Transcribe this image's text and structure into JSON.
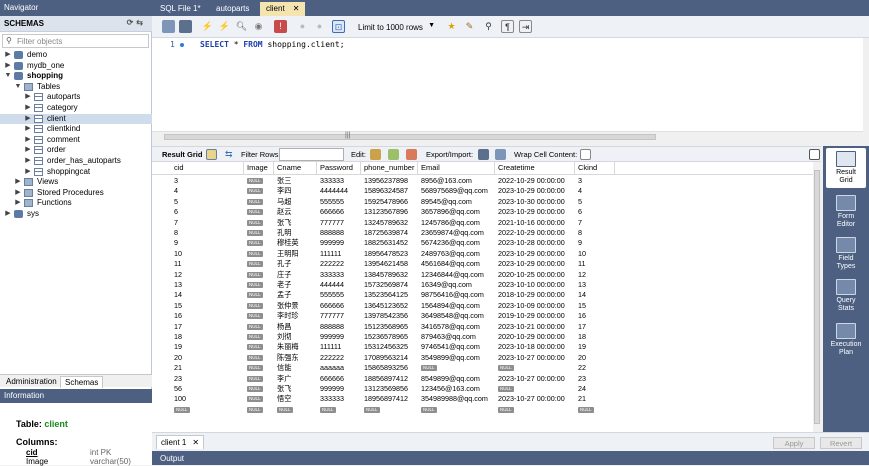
{
  "navigator": {
    "title": "Navigator",
    "schemas_header": "SCHEMAS",
    "filter_placeholder": "Filter objects",
    "tree": [
      {
        "label": "demo",
        "level": 0,
        "type": "db",
        "arrow": "▶",
        "bold": false,
        "selected": false
      },
      {
        "label": "mydb_one",
        "level": 0,
        "type": "db",
        "arrow": "▶",
        "bold": false,
        "selected": false
      },
      {
        "label": "shopping",
        "level": 0,
        "type": "db",
        "arrow": "▼",
        "bold": true,
        "selected": false
      },
      {
        "label": "Tables",
        "level": 1,
        "type": "folder",
        "arrow": "▼",
        "bold": false,
        "selected": false
      },
      {
        "label": "autoparts",
        "level": 2,
        "type": "table",
        "arrow": "▶",
        "bold": false,
        "selected": false
      },
      {
        "label": "category",
        "level": 2,
        "type": "table",
        "arrow": "▶",
        "bold": false,
        "selected": false
      },
      {
        "label": "client",
        "level": 2,
        "type": "table",
        "arrow": "▶",
        "bold": false,
        "selected": true
      },
      {
        "label": "clientkind",
        "level": 2,
        "type": "table",
        "arrow": "▶",
        "bold": false,
        "selected": false
      },
      {
        "label": "comment",
        "level": 2,
        "type": "table",
        "arrow": "▶",
        "bold": false,
        "selected": false
      },
      {
        "label": "order",
        "level": 2,
        "type": "table",
        "arrow": "▶",
        "bold": false,
        "selected": false
      },
      {
        "label": "order_has_autoparts",
        "level": 2,
        "type": "table",
        "arrow": "▶",
        "bold": false,
        "selected": false
      },
      {
        "label": "shoppingcat",
        "level": 2,
        "type": "table",
        "arrow": "▶",
        "bold": false,
        "selected": false
      },
      {
        "label": "Views",
        "level": 1,
        "type": "folder",
        "arrow": "▶",
        "bold": false,
        "selected": false
      },
      {
        "label": "Stored Procedures",
        "level": 1,
        "type": "folder",
        "arrow": "▶",
        "bold": false,
        "selected": false
      },
      {
        "label": "Functions",
        "level": 1,
        "type": "folder",
        "arrow": "▶",
        "bold": false,
        "selected": false
      },
      {
        "label": "sys",
        "level": 0,
        "type": "db",
        "arrow": "▶",
        "bold": false,
        "selected": false
      }
    ],
    "tabs": {
      "administration": "Administration",
      "schemas": "Schemas"
    },
    "info_title": "Information",
    "info": {
      "table_label": "Table:",
      "table_name": "client",
      "columns_label": "Columns:",
      "columns": [
        {
          "name": "cid",
          "type": "int PK"
        },
        {
          "name": "Image",
          "type": "varchar(50)"
        }
      ]
    }
  },
  "doc_tabs": [
    {
      "label": "SQL File 1*",
      "active": false,
      "closable": false
    },
    {
      "label": "autoparts",
      "active": false,
      "closable": false
    },
    {
      "label": "client",
      "active": true,
      "closable": true
    }
  ],
  "toolbar": {
    "limit_label": "Limit to 1000 rows"
  },
  "editor": {
    "line_number": "1",
    "sql": {
      "kw1": "SELECT",
      "star": " * ",
      "kw2": "FROM",
      "rest": " shopping.client;"
    }
  },
  "result_toolbar": {
    "result_grid": "Result Grid",
    "filter_rows": "Filter Rows:",
    "edit": "Edit:",
    "export_import": "Export/Import:",
    "wrap": "Wrap Cell Content:"
  },
  "grid": {
    "columns": [
      "cid",
      "Image",
      "Cname",
      "Password",
      "phone_number",
      "Email",
      "Createtime",
      "Ckind"
    ],
    "null_label": "NULL",
    "rows": [
      [
        "3",
        "NULL",
        "张三",
        "333333",
        "13956237898",
        "8956@163.com",
        "2022-10-29 00:00:00",
        "3"
      ],
      [
        "4",
        "NULL",
        "李四",
        "4444444",
        "15896324587",
        "568975689@qq.com",
        "2023-10-29 00:00:00",
        "4"
      ],
      [
        "5",
        "NULL",
        "马超",
        "555555",
        "15925478966",
        "89545@qq.com",
        "2023-10-30 00:00:00",
        "5"
      ],
      [
        "6",
        "NULL",
        "赵云",
        "666666",
        "13123567896",
        "3657896@qq.com",
        "2023-10-29 00:00:00",
        "6"
      ],
      [
        "7",
        "NULL",
        "张飞",
        "777777",
        "13245789632",
        "1245786@qq.com",
        "2021-10-16 00:00:00",
        "7"
      ],
      [
        "8",
        "NULL",
        "孔明",
        "888888",
        "18725639874",
        "23659874@qq.com",
        "2022-10-29 00:00:00",
        "8"
      ],
      [
        "9",
        "NULL",
        "穆桂英",
        "999999",
        "18825631452",
        "5674236@qq.com",
        "2023-10-28 00:00:00",
        "9"
      ],
      [
        "10",
        "NULL",
        "王明阳",
        "111111",
        "18956478523",
        "2489763@qq.com",
        "2023-10-29 00:00:00",
        "10"
      ],
      [
        "11",
        "NULL",
        "孔子",
        "222222",
        "13954621458",
        "4561684@qq.com",
        "2023-10-29 00:00:00",
        "11"
      ],
      [
        "12",
        "NULL",
        "庄子",
        "333333",
        "13845789632",
        "12346844@qq.com",
        "2020-10-25 00:00:00",
        "12"
      ],
      [
        "13",
        "NULL",
        "老子",
        "444444",
        "15732569874",
        "16349@qq.com",
        "2023-10-10 00:00:00",
        "13"
      ],
      [
        "14",
        "NULL",
        "孟子",
        "555555",
        "13523564125",
        "98756416@qq.com",
        "2018-10-29 00:00:00",
        "14"
      ],
      [
        "15",
        "NULL",
        "张仲景",
        "666666",
        "13645123652",
        "1564894@qq.com",
        "2023-10-09 00:00:00",
        "15"
      ],
      [
        "16",
        "NULL",
        "李时珍",
        "777777",
        "13978542356",
        "36498548@qq.com",
        "2019-10-29 00:00:00",
        "16"
      ],
      [
        "17",
        "NULL",
        "杨昌",
        "888888",
        "15123568965",
        "3416578@qq.com",
        "2023-10-21 00:00:00",
        "17"
      ],
      [
        "18",
        "NULL",
        "刘彻",
        "999999",
        "15236578965",
        "879463@qq.com",
        "2020-10-29 00:00:00",
        "18"
      ],
      [
        "19",
        "NULL",
        "朱丽梅",
        "111111",
        "15312456325",
        "9746541@qq.com",
        "2023-10-18 00:00:00",
        "19"
      ],
      [
        "20",
        "NULL",
        "陈强东",
        "222222",
        "17089563214",
        "3549899@qq.com",
        "2023-10-27 00:00:00",
        "20"
      ],
      [
        "21",
        "NULL",
        "信能",
        "aaaaaa",
        "15865893256",
        "NULL",
        "NULL",
        "22"
      ],
      [
        "23",
        "NULL",
        "李广",
        "666666",
        "18856897412",
        "8549899@qq.com",
        "2023-10-27 00:00:00",
        "23"
      ],
      [
        "56",
        "NULL",
        "张飞",
        "999999",
        "13123569856",
        "123456@163.com",
        "NULL",
        "24"
      ],
      [
        "100",
        "NULL",
        "悟空",
        "333333",
        "18956897412",
        "354989988@qq.com",
        "2023-10-27 00:00:00",
        "21"
      ],
      [
        "NULL",
        "NULL",
        "NULL",
        "NULL",
        "NULL",
        "NULL",
        "NULL",
        "NULL"
      ]
    ]
  },
  "side_panel": [
    {
      "label1": "Result",
      "label2": "Grid",
      "active": true
    },
    {
      "label1": "Form",
      "label2": "Editor",
      "active": false
    },
    {
      "label1": "Field",
      "label2": "Types",
      "active": false
    },
    {
      "label1": "Query",
      "label2": "Stats",
      "active": false
    },
    {
      "label1": "Execution",
      "label2": "Plan",
      "active": false
    }
  ],
  "bottom": {
    "result_tab": "client 1",
    "apply": "Apply",
    "revert": "Revert",
    "output": "Output"
  },
  "colors": {
    "header_blue": "#4d6082",
    "active_tab": "#f4e4b0",
    "selected_row": "#cfdcec"
  }
}
